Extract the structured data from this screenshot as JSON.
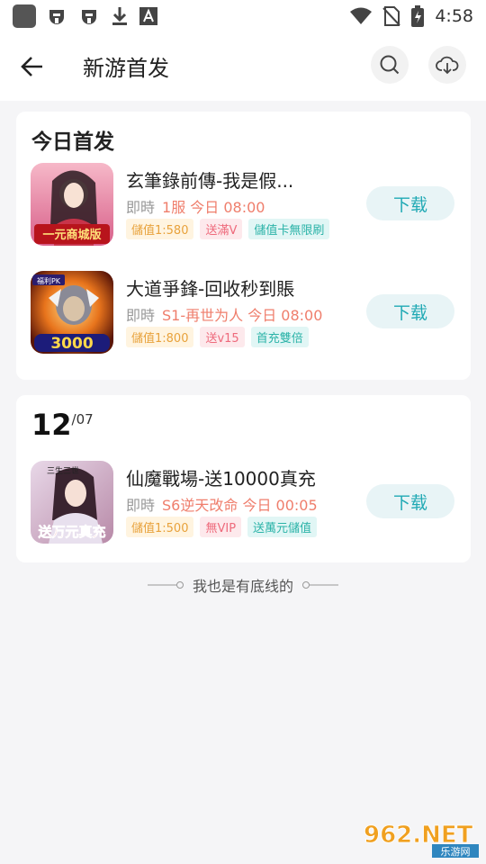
{
  "status_bar": {
    "time": "4:58"
  },
  "header": {
    "title": "新游首发"
  },
  "sections": [
    {
      "title": "今日首发",
      "games": [
        {
          "name": "玄筆錄前傳-我是假...",
          "lead": "即時",
          "server": "1服 今日 08:00",
          "tags": [
            "儲值1:580",
            "送滿V",
            "儲值卡無限刷"
          ],
          "download": "下载",
          "thumb_text": "一元商城版"
        },
        {
          "name": "大道爭鋒-回收秒到賬",
          "lead": "即時",
          "server": "S1-再世为人 今日 08:00",
          "tags": [
            "儲值1:800",
            "送v15",
            "首充雙倍"
          ],
          "download": "下载",
          "thumb_text": "3000"
        }
      ]
    },
    {
      "date_day": "12",
      "date_month": "/07",
      "games": [
        {
          "name": "仙魔戰場-送10000真充",
          "lead": "即時",
          "server": "S6逆天改命 今日 00:05",
          "tags": [
            "儲值1:500",
            "無VIP",
            "送萬元儲值"
          ],
          "download": "下载",
          "thumb_text": "送万元真充"
        }
      ]
    }
  ],
  "footer": {
    "text": "我也是有底线的"
  },
  "watermark": {
    "brand": "962.NET",
    "sub": "乐游网"
  },
  "colors": {
    "accent": "#20a9b4",
    "highlight": "#ef7e6c"
  }
}
